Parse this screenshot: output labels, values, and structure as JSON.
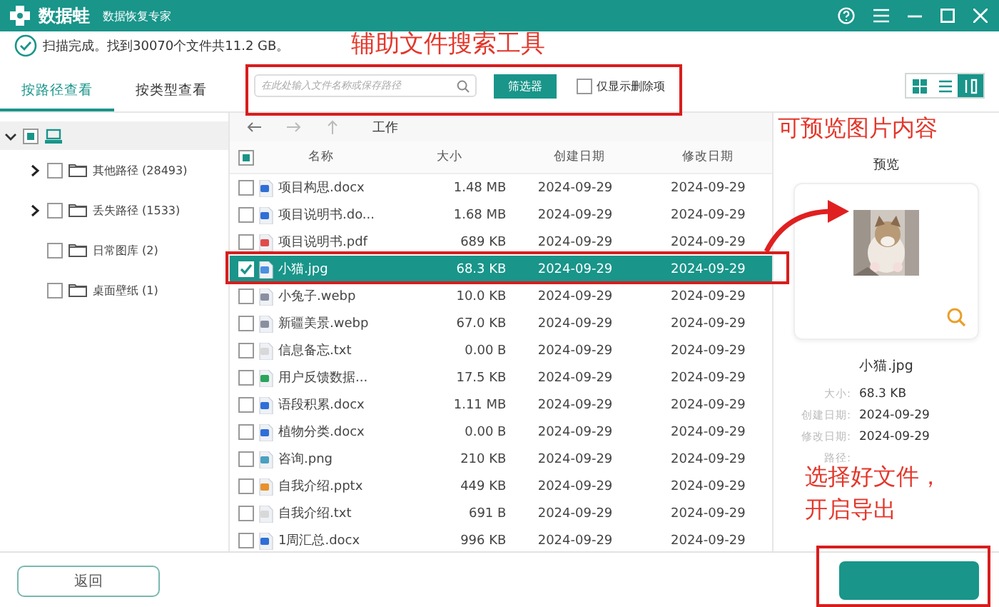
{
  "window": {
    "app_name": "数据蛙",
    "subtitle": "数据恢复专家"
  },
  "status": {
    "text": "扫描完成。找到30070个文件共11.2 GB。"
  },
  "view_tabs": [
    {
      "label": "按路径查看",
      "selected": true
    },
    {
      "label": "按类型查看",
      "selected": false
    }
  ],
  "search": {
    "placeholder": "在此处输入文件名称或保存路径"
  },
  "filter_button": "筛选器",
  "deleted_only": {
    "label": "仅显示删除项",
    "checked": false
  },
  "view_modes": [
    {
      "kind": "grid",
      "selected": false
    },
    {
      "kind": "list",
      "selected": false
    },
    {
      "kind": "detail",
      "selected": true
    }
  ],
  "tree": [
    {
      "partial": true,
      "expanded": true,
      "children": [
        {
          "label": "其他路径 (28493)",
          "checked": false,
          "partial": false,
          "kind": "collapsed"
        },
        {
          "label": "丢失路径 (1533)",
          "checked": false,
          "partial": false,
          "kind": "collapsed"
        },
        {
          "label": "日常图库 (2)",
          "checked": false,
          "partial": false,
          "kind": "leaf"
        },
        {
          "label": "桌面壁纸 (1)",
          "checked": false,
          "partial": false,
          "kind": "leaf"
        }
      ]
    }
  ],
  "path": "工作",
  "table": {
    "header_partial": true,
    "columns": [
      "名称",
      "大小",
      "创建日期",
      "修改日期"
    ],
    "rows": [
      {
        "kind": "docx",
        "name": "项目构思.docx",
        "size": "1.48 MB",
        "created": "2024-09-29",
        "modified": "2024-09-29",
        "checked": false,
        "selected": false
      },
      {
        "kind": "docx",
        "name": "项目说明书.do...",
        "size": "1.68 MB",
        "created": "2024-09-29",
        "modified": "2024-09-29",
        "checked": false,
        "selected": false
      },
      {
        "kind": "pdf",
        "name": "项目说明书.pdf",
        "size": "689 KB",
        "created": "2024-09-29",
        "modified": "2024-09-29",
        "checked": false,
        "selected": false
      },
      {
        "kind": "jpg",
        "name": "小猫.jpg",
        "size": "68.3 KB",
        "created": "2024-09-29",
        "modified": "2024-09-29",
        "checked": true,
        "selected": true
      },
      {
        "kind": "webp",
        "name": "小兔子.webp",
        "size": "10.0 KB",
        "created": "2024-09-29",
        "modified": "2024-09-29",
        "checked": false,
        "selected": false
      },
      {
        "kind": "webp",
        "name": "新疆美景.webp",
        "size": "67.0 KB",
        "created": "2024-09-29",
        "modified": "2024-09-29",
        "checked": false,
        "selected": false
      },
      {
        "kind": "txt",
        "name": "信息备忘.txt",
        "size": "0.00  B",
        "created": "2024-09-29",
        "modified": "2024-09-29",
        "checked": false,
        "selected": false
      },
      {
        "kind": "xlsx",
        "name": "用户反馈数据...",
        "size": "17.5 KB",
        "created": "2024-09-29",
        "modified": "2024-09-29",
        "checked": false,
        "selected": false
      },
      {
        "kind": "docx",
        "name": "语段积累.docx",
        "size": "1.11 MB",
        "created": "2024-09-29",
        "modified": "2024-09-29",
        "checked": false,
        "selected": false
      },
      {
        "kind": "docx",
        "name": "植物分类.docx",
        "size": "0.00  B",
        "created": "2024-09-29",
        "modified": "2024-09-29",
        "checked": false,
        "selected": false
      },
      {
        "kind": "png",
        "name": "咨询.png",
        "size": "210 KB",
        "created": "2024-09-29",
        "modified": "2024-09-29",
        "checked": false,
        "selected": false
      },
      {
        "kind": "pptx",
        "name": "自我介绍.pptx",
        "size": "449 KB",
        "created": "2024-09-29",
        "modified": "2024-09-29",
        "checked": false,
        "selected": false
      },
      {
        "kind": "txt",
        "name": "自我介绍.txt",
        "size": "691  B",
        "created": "2024-09-29",
        "modified": "2024-09-29",
        "checked": false,
        "selected": false
      },
      {
        "kind": "docx",
        "name": "1周汇总.docx",
        "size": "996 KB",
        "created": "2024-09-29",
        "modified": "2024-09-29",
        "checked": false,
        "selected": false
      }
    ]
  },
  "preview": {
    "title": "预览",
    "file_name": "小猫.jpg",
    "details": [
      {
        "label": "大小:",
        "value": "68.3 KB"
      },
      {
        "label": "创建日期:",
        "value": "2024-09-29"
      },
      {
        "label": "修改日期:",
        "value": "2024-09-29"
      },
      {
        "label": "路径:"
      }
    ]
  },
  "back_button": "返回",
  "annotations": {
    "texts": [
      {
        "kind": "search",
        "text": "辅助文件搜索工具"
      },
      {
        "kind": "preview",
        "text": "可预览图片内容"
      },
      {
        "kind": "export",
        "text": "选择好文件，开启导出"
      }
    ]
  }
}
